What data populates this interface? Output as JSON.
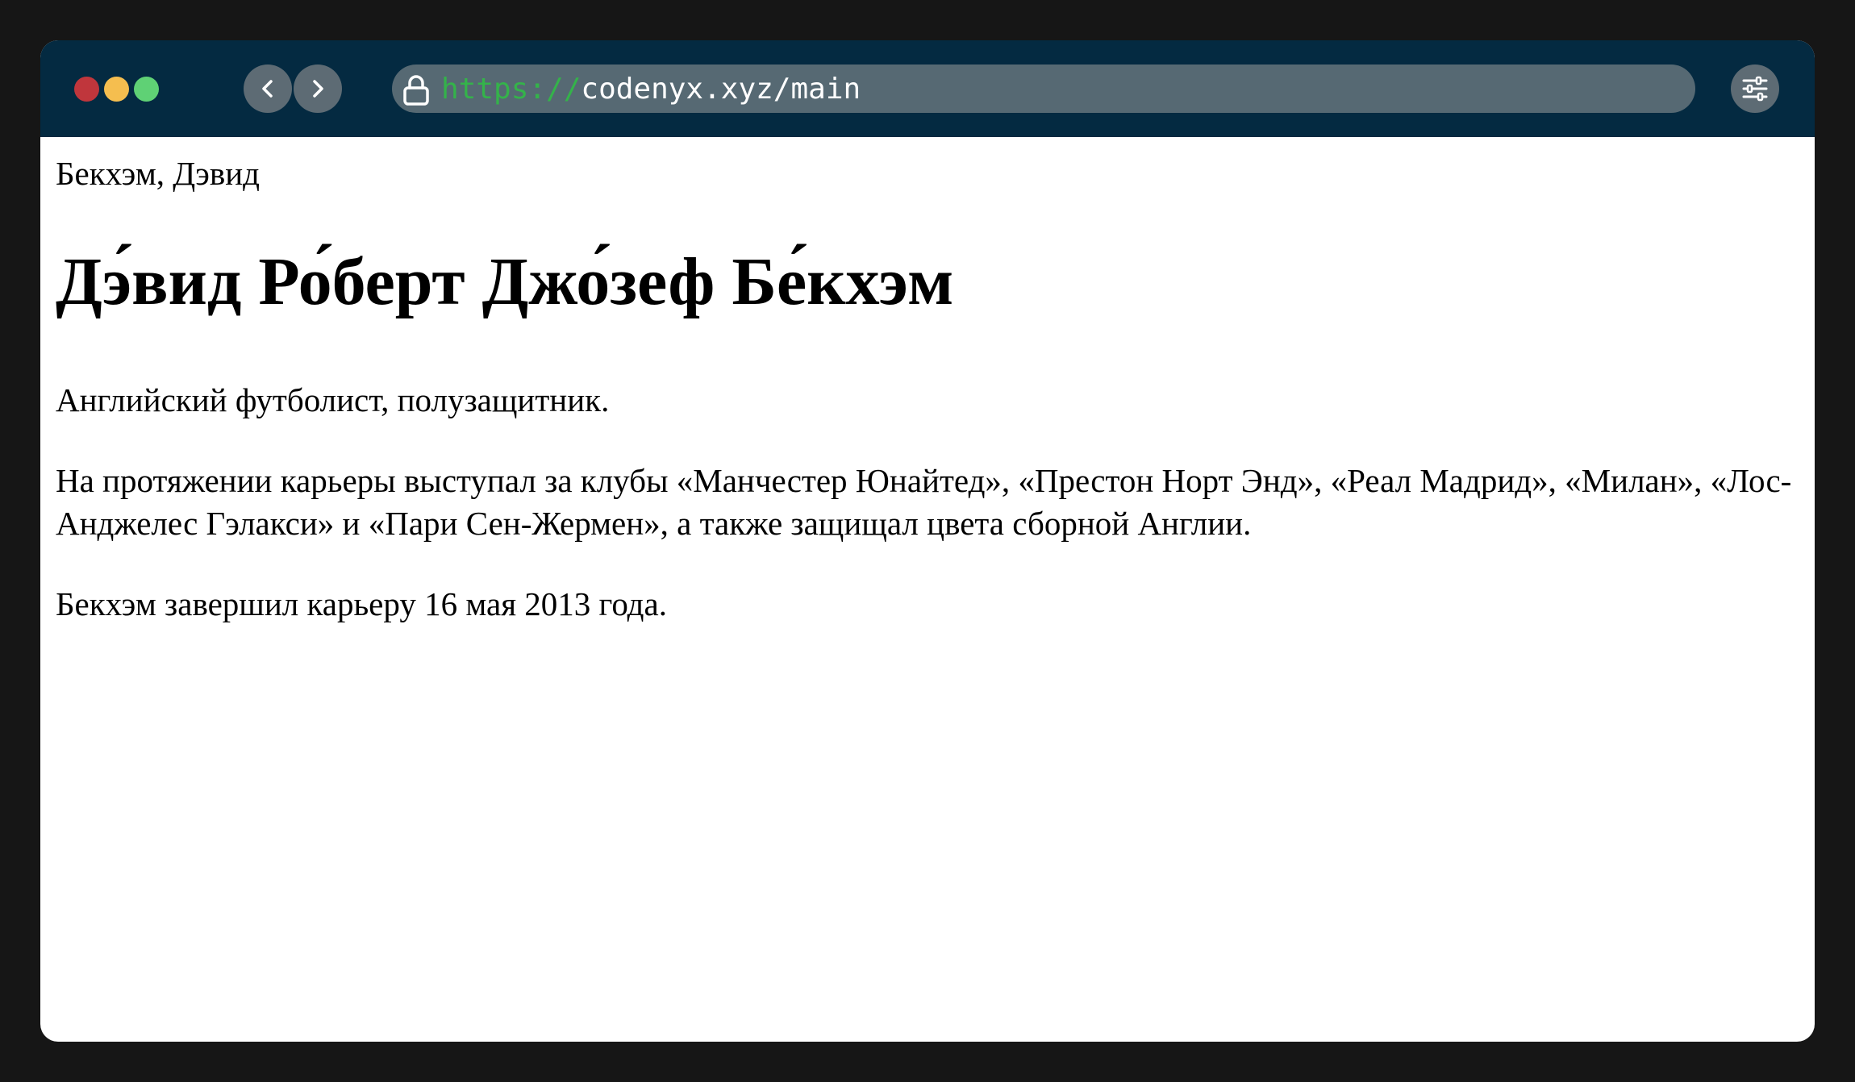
{
  "browser": {
    "url_scheme": "https://",
    "url_rest": "codenyx.xyz/main",
    "traffic_light_colors": [
      "#c0363c",
      "#f5be4f",
      "#5fd175"
    ],
    "titlebar_color": "#042a41"
  },
  "page": {
    "breadcrumb": "Бекхэм, Дэвид",
    "title": "Дэ́вид Ро́берт Джо́зеф Бе́кхэм",
    "paragraphs": [
      "Английский футболист, полузащитник.",
      "На протяжении карьеры выступал за клубы «Манчестер Юнайтед», «Престон Норт Энд», «Реал Мадрид», «Милан», «Лос-Анджелес Гэлакси» и «Пари Сен-Жермен», а также защищал цвета сборной Англии.",
      "Бекхэм завершил карьеру 16 мая 2013 года."
    ]
  },
  "icons": {
    "back": "chevron-left-icon",
    "forward": "chevron-right-icon",
    "lock": "lock-icon",
    "settings": "sliders-icon"
  }
}
